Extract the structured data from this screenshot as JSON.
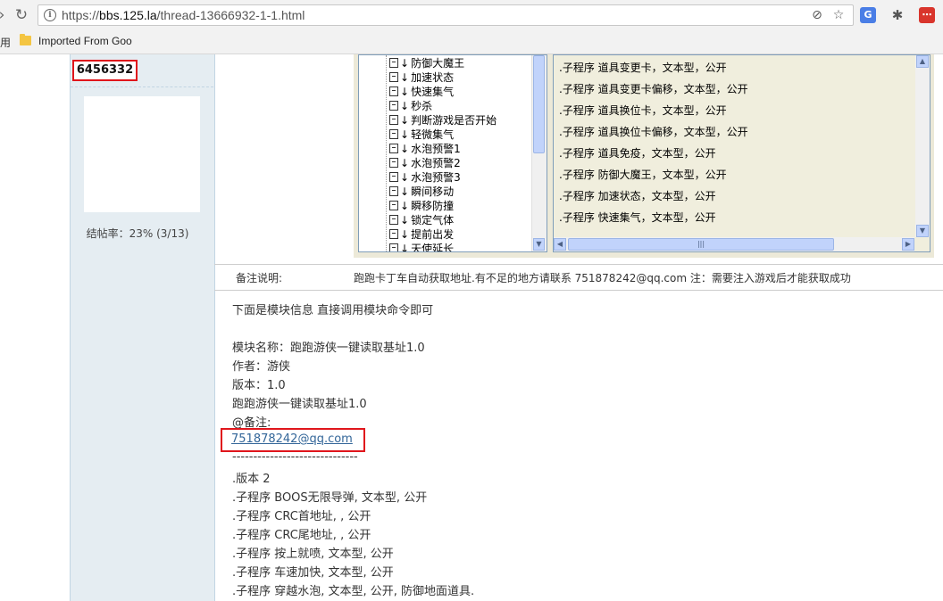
{
  "browser": {
    "url_scheme": "https://",
    "url_host": "bbs.125.la",
    "url_path": "/thread-13666932-1-1.html",
    "bookmarks_apps_label": "用",
    "bookmark_folder_label": "Imported From Goo"
  },
  "sidebar": {
    "uid": "6456332",
    "rate_text": "结帖率：23% (3/13)"
  },
  "tree": {
    "items": [
      "防御大魔王",
      "加速状态",
      "快速集气",
      "秒杀",
      "判断游戏是否开始",
      "轻微集气",
      "水泡预警1",
      "水泡预警2",
      "水泡预警3",
      "瞬间移动",
      "瞬移防撞",
      "锁定气体",
      "提前出发",
      "天使延长"
    ]
  },
  "list": {
    "items": [
      ".子程序  道具变更卡，文本型，公开",
      ".子程序  道具变更卡偏移，文本型，公开",
      ".子程序  道具换位卡，文本型，公开",
      ".子程序  道具换位卡偏移，文本型，公开",
      ".子程序  道具免疫，文本型，公开",
      ".子程序  防御大魔王，文本型，公开",
      ".子程序  加速状态，文本型，公开",
      ".子程序  快速集气，文本型，公开"
    ]
  },
  "note": {
    "label": "备注说明:",
    "text": "跑跑卡丁车自动获取地址.有不足的地方请联系 751878242@qq.com 注：需要注入游戏后才能获取成功"
  },
  "content": {
    "intro": "下面是模块信息  直接调用模块命令即可",
    "module_name": "模块名称：跑跑游侠一键读取基址1.0",
    "author": "作者：游侠",
    "version": "版本：1.0",
    "desc": "跑跑游侠一键读取基址1.0",
    "remark": "@备注:",
    "email": "751878242@qq.com",
    "divider": "------------------------------",
    "code_lines": [
      ".版本 2",
      ".子程序 BOOS无限导弹, 文本型, 公开",
      ".子程序 CRC首地址, , 公开",
      ".子程序 CRC尾地址, , 公开",
      ".子程序 按上就喷, 文本型, 公开",
      ".子程序 车速加快, 文本型, 公开",
      ".子程序 穿越水泡, 文本型, 公开, 防御地面道具."
    ]
  }
}
